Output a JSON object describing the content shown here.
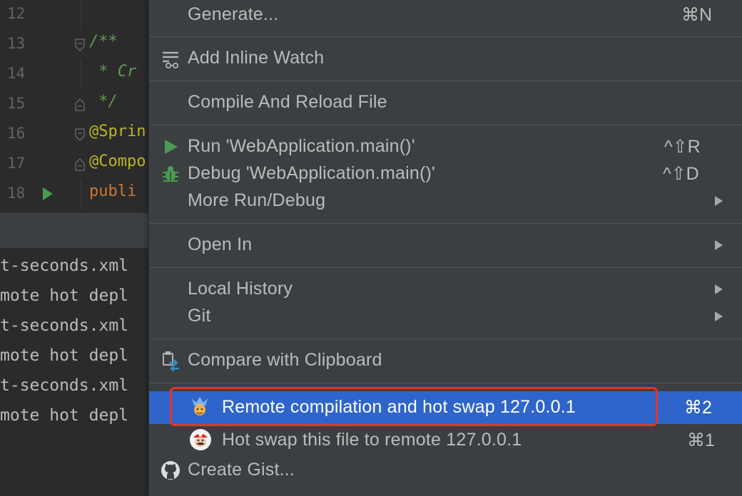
{
  "editor": {
    "lines": [
      {
        "num": "12",
        "code": ""
      },
      {
        "num": "13",
        "code": "/**"
      },
      {
        "num": "14",
        "code": " * Cr"
      },
      {
        "num": "15",
        "code": " */"
      },
      {
        "num": "16",
        "code": "@Sprin"
      },
      {
        "num": "17",
        "code": "@Compo"
      },
      {
        "num": "18",
        "code": "publi"
      }
    ]
  },
  "console": {
    "lines": [
      "t-seconds.xml",
      "mote hot depl",
      "t-seconds.xml",
      "mote hot depl",
      "t-seconds.xml",
      "mote hot depl"
    ]
  },
  "menu": {
    "generate": {
      "label": "Generate...",
      "shortcut": "⌘N"
    },
    "add_inline_watch": {
      "label": "Add Inline Watch",
      "icon": "inline-watch-icon"
    },
    "compile_reload": {
      "label": "Compile And Reload File"
    },
    "run": {
      "label": "Run 'WebApplication.main()'",
      "shortcut": "^⇧R",
      "icon": "run-icon"
    },
    "debug": {
      "label": "Debug 'WebApplication.main()'",
      "shortcut": "^⇧D",
      "icon": "debug-icon"
    },
    "more_run_debug": {
      "label": "More Run/Debug"
    },
    "open_in": {
      "label": "Open In"
    },
    "local_history": {
      "label": "Local History"
    },
    "git": {
      "label": "Git"
    },
    "compare_clipboard": {
      "label": "Compare with Clipboard",
      "icon": "compare-clipboard-icon"
    },
    "remote_compile": {
      "label": "Remote compilation and hot swap 127.0.0.1",
      "shortcut": "⌘2",
      "icon": "hotswap-character-icon"
    },
    "hot_swap_file": {
      "label": "Hot swap this file to remote 127.0.0.1",
      "shortcut": "⌘1",
      "icon": "mario-icon"
    },
    "create_gist": {
      "label": "Create Gist...",
      "icon": "github-icon"
    }
  },
  "colors": {
    "menu_bg": "#3c3f41",
    "selected_bg": "#2f65ca",
    "highlight_border": "#e5342b",
    "run_green": "#499c54"
  }
}
